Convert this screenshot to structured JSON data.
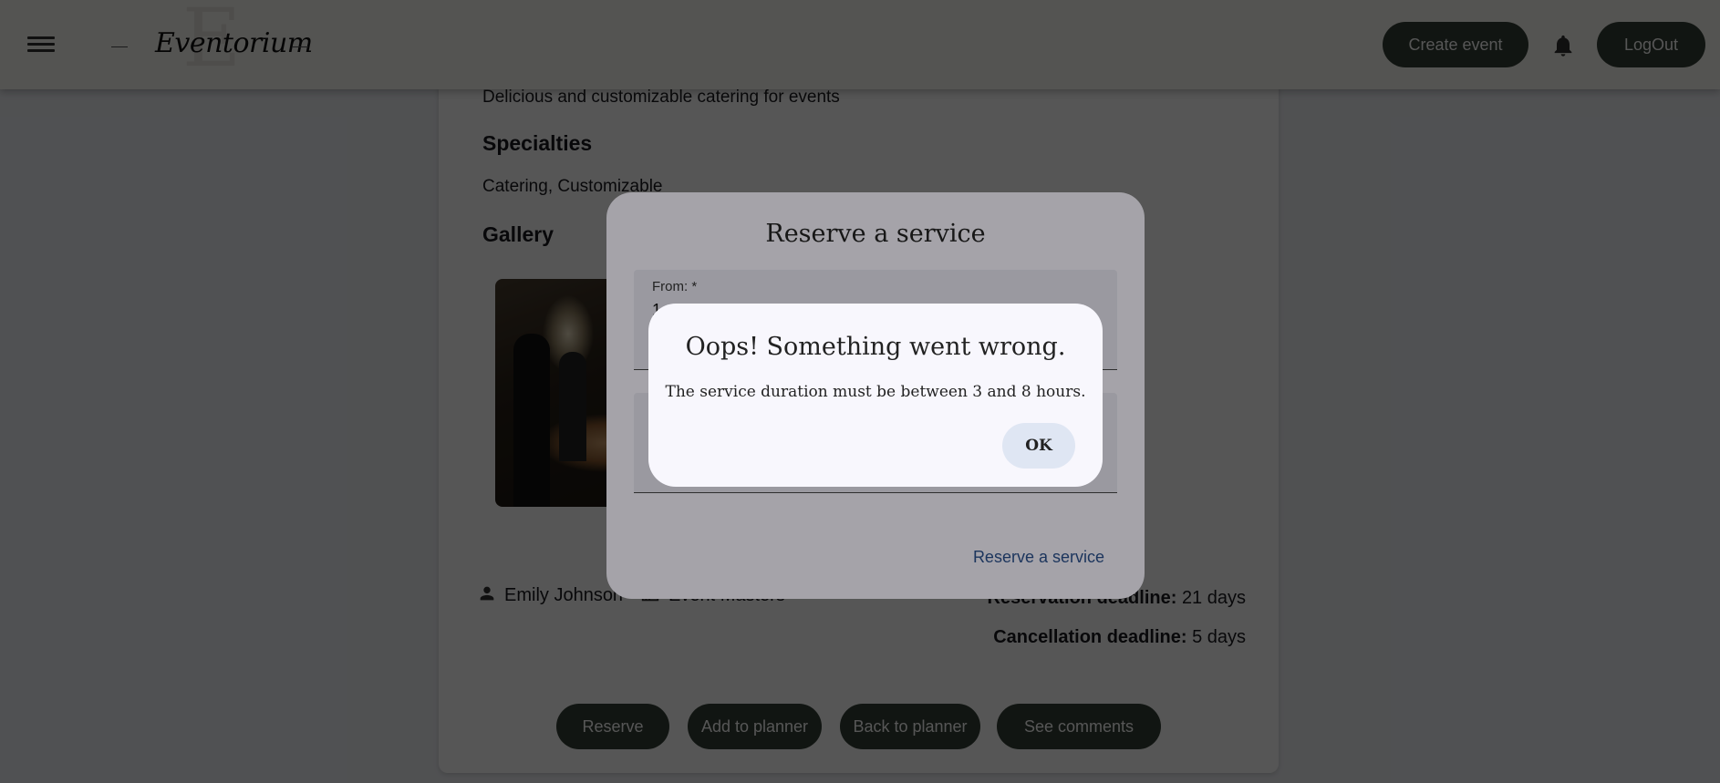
{
  "header": {
    "logo_text": "Eventorium",
    "logo_mark": "E",
    "create_event_label": "Create event",
    "logout_label": "LogOut"
  },
  "service": {
    "description": "Delicious and customizable catering for events",
    "specialties_heading": "Specialties",
    "specialties": "Catering, Customizable",
    "gallery_heading": "Gallery",
    "owner": "Emily Johnson",
    "company": "Event Masters",
    "reservation_deadline_label": "Reservation deadline:",
    "reservation_deadline_value": "21 days",
    "cancellation_deadline_label": "Cancellation deadline:",
    "cancellation_deadline_value": "5 days",
    "buttons": {
      "reserve": "Reserve",
      "add_to_planner": "Add to planner",
      "back_to_planner": "Back to planner",
      "see_comments": "See comments"
    }
  },
  "reserve_dialog": {
    "title": "Reserve a service",
    "from_label": "From: *",
    "from_value": "1",
    "action_label": "Reserve a service"
  },
  "error_dialog": {
    "title": "Oops! Something went wrong.",
    "message": "The service duration must be between 3 and 8 hours.",
    "ok_label": "OK"
  },
  "colors": {
    "primary_button": "#354036",
    "link": "#2a4f8a",
    "dialog_bg": "#f3f1f9"
  }
}
